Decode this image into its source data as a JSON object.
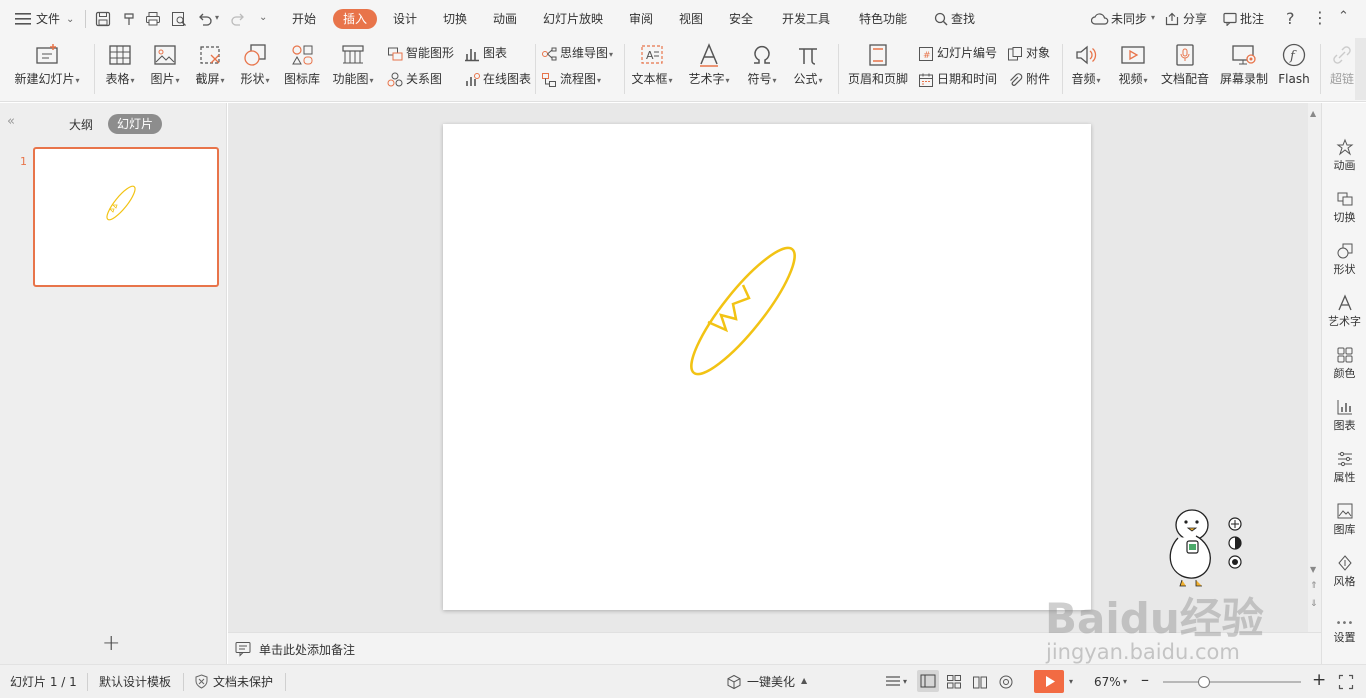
{
  "menubar": {
    "file_label": "文件",
    "tabs": [
      "开始",
      "插入",
      "设计",
      "切换",
      "动画",
      "幻灯片放映",
      "审阅",
      "视图",
      "安全",
      "开发工具",
      "特色功能"
    ],
    "active_tab": "插入",
    "search_label": "查找",
    "sync_label": "未同步",
    "share_label": "分享",
    "comment_label": "批注",
    "accent_color": "#e8744a"
  },
  "ribbon": {
    "new_slide": "新建幻灯片",
    "table": "表格",
    "picture": "图片",
    "screenshot": "截屏",
    "shape": "形状",
    "icon_lib": "图标库",
    "function_chart": "功能图",
    "smart_art": "智能图形",
    "chart": "图表",
    "relation": "关系图",
    "online_chart": "在线图表",
    "mindmap": "思维导图",
    "flowchart": "流程图",
    "textbox": "文本框",
    "wordart": "艺术字",
    "symbol": "符号",
    "formula": "公式",
    "header_footer": "页眉和页脚",
    "slide_number": "幻灯片编号",
    "object": "对象",
    "datetime": "日期和时间",
    "attachment": "附件",
    "audio": "音频",
    "video": "视频",
    "doc_dubbing": "文档配音",
    "screen_record": "屏幕录制",
    "flash": "Flash",
    "hyperlink": "超链"
  },
  "leftpane": {
    "outline_tab": "大纲",
    "slides_tab": "幻灯片",
    "slide_number": "1",
    "add_label": "+"
  },
  "notes": {
    "placeholder": "单击此处添加备注"
  },
  "rightpane": {
    "tools": [
      "动画",
      "切换",
      "形状",
      "艺术字",
      "颜色",
      "图表",
      "属性",
      "图库",
      "风格",
      "设置"
    ]
  },
  "statusbar": {
    "slide_info": "幻灯片 1 / 1",
    "template": "默认设计模板",
    "protection": "文档未保护",
    "beautify": "一键美化",
    "zoom": "67%",
    "zoom_fraction": 0.3
  },
  "slide": {
    "shape_color": "#f2c314"
  },
  "watermark": {
    "brand": "Baidu经验",
    "url": "jingyan.baidu.com"
  }
}
